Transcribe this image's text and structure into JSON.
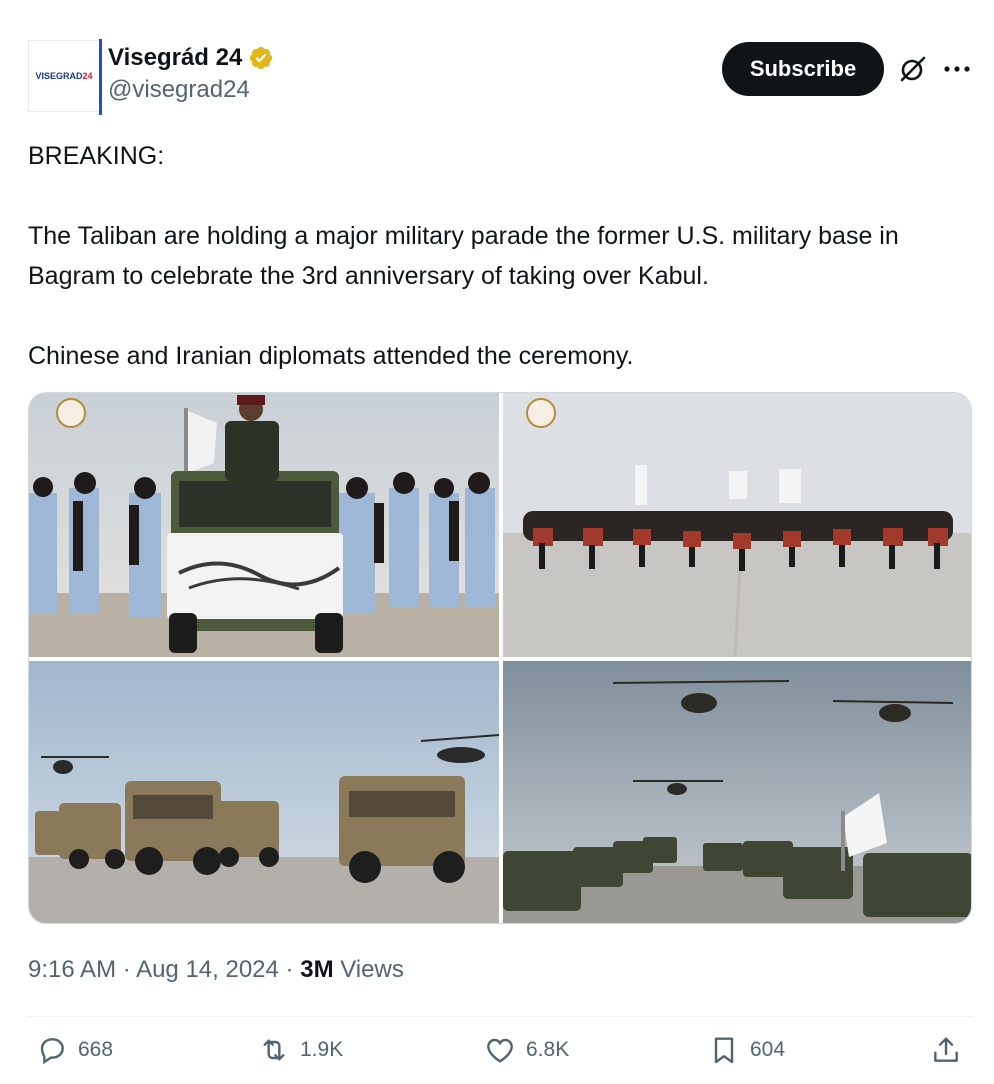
{
  "account": {
    "avatar_text_blue": "VISEGRAD",
    "avatar_text_red": "24",
    "display_name": "Visegrád 24",
    "handle": "@visegrad24",
    "verified": true,
    "verified_color": "#e2b719"
  },
  "header": {
    "subscribe_label": "Subscribe",
    "icons": [
      "grok-icon",
      "more-icon"
    ]
  },
  "tweet": {
    "text": "BREAKING:\n\nThe Taliban are holding a major military parade the former U.S. military base in Bagram to celebrate the 3rd anniversary of taking over Kabul.\n\nChinese and Iranian diplomats attended the ceremony.",
    "time": "9:16 AM",
    "date": "Aug 14, 2024",
    "views_count": "3M",
    "views_label": "Views"
  },
  "media": {
    "photos": [
      "parade-vehicle-photo",
      "motorcycle-formation-photo",
      "armored-vehicles-photo",
      "helicopters-convoy-photo"
    ]
  },
  "actions": {
    "replies": "668",
    "reposts": "1.9K",
    "likes": "6.8K",
    "bookmarks": "604"
  },
  "colors": {
    "text_primary": "#0f1419",
    "text_secondary": "#536471",
    "button_bg": "#0f1419"
  }
}
